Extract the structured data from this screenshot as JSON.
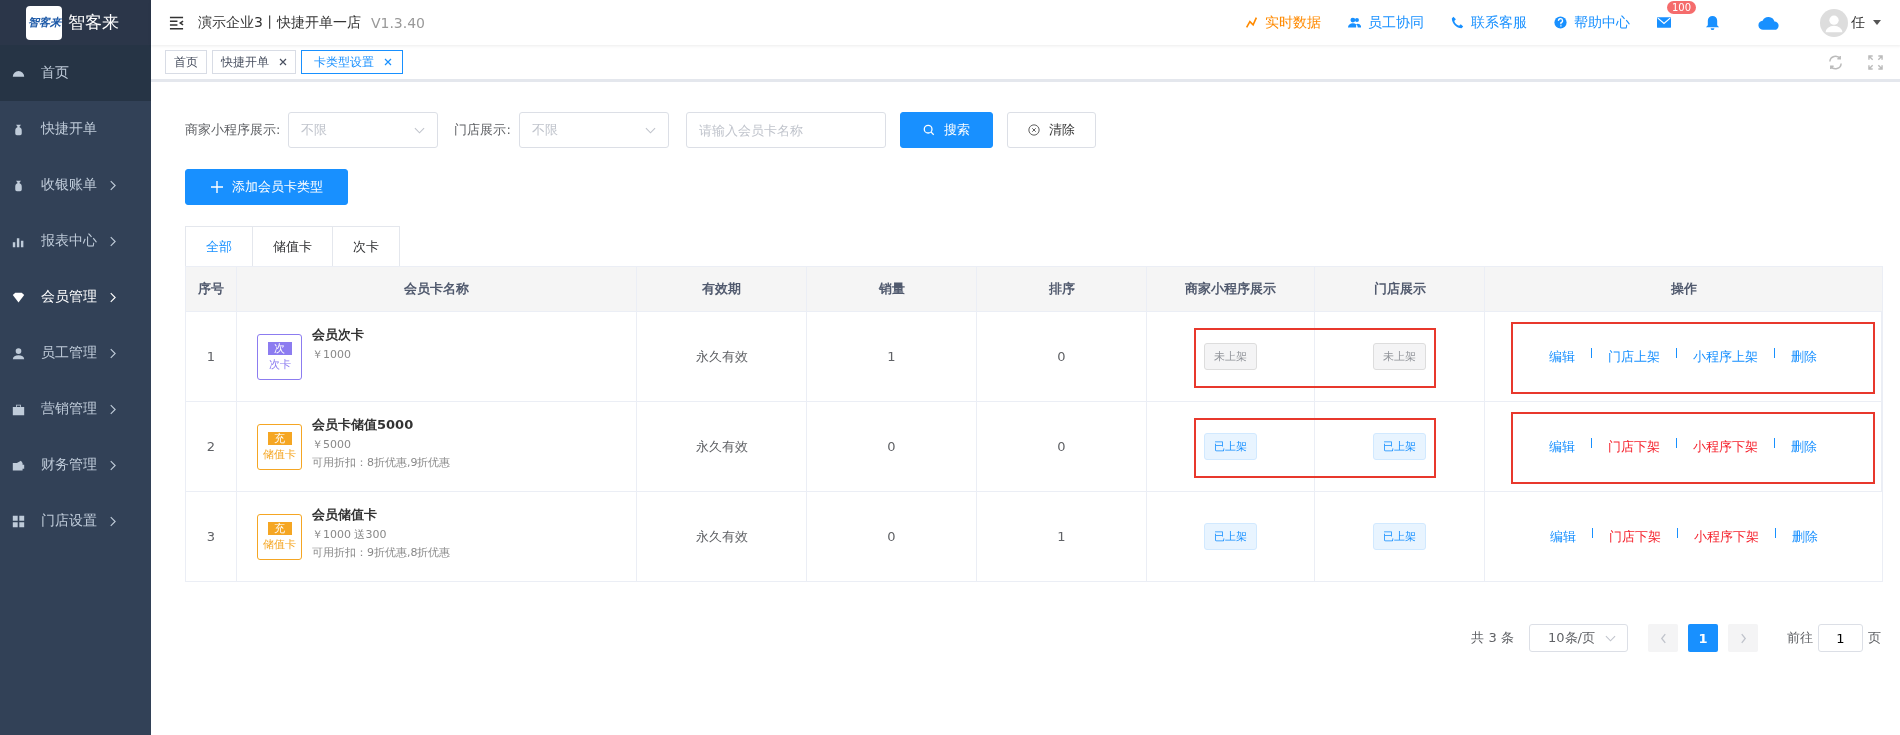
{
  "logo": {
    "name": "智客来",
    "badge_text": "智客来"
  },
  "header": {
    "title": "演示企业3丨快捷开单一店",
    "version": "V1.3.40",
    "links": [
      {
        "label": "实时数据",
        "kind": "chart",
        "color": "#ff8a00"
      },
      {
        "label": "员工协同",
        "kind": "users",
        "color": "#1890ff"
      },
      {
        "label": "联系客服",
        "kind": "phone",
        "color": "#1890ff"
      },
      {
        "label": "帮助中心",
        "kind": "help",
        "color": "#1890ff"
      }
    ],
    "mail_badge": "100",
    "user": "任"
  },
  "page_tabs": [
    {
      "label": "首页",
      "selected": false,
      "closable": false
    },
    {
      "label": "快捷开单",
      "selected": false,
      "closable": true
    },
    {
      "label": "卡类型设置",
      "selected": true,
      "closable": true
    }
  ],
  "sidebar": {
    "items": [
      {
        "label": "首页",
        "selected": true,
        "current": false,
        "has_children": false
      },
      {
        "label": "快捷开单",
        "selected": false,
        "current": false,
        "has_children": false
      },
      {
        "label": "收银账单",
        "selected": false,
        "current": false,
        "has_children": true
      },
      {
        "label": "报表中心",
        "selected": false,
        "current": false,
        "has_children": true
      },
      {
        "label": "会员管理",
        "selected": false,
        "current": true,
        "has_children": true
      },
      {
        "label": "员工管理",
        "selected": false,
        "current": false,
        "has_children": true
      },
      {
        "label": "营销管理",
        "selected": false,
        "current": false,
        "has_children": true
      },
      {
        "label": "财务管理",
        "selected": false,
        "current": false,
        "has_children": true
      },
      {
        "label": "门店设置",
        "selected": false,
        "current": false,
        "has_children": true
      }
    ]
  },
  "filters": {
    "mini_label": "商家小程序展示:",
    "mini_placeholder": "不限",
    "store_label": "门店展示:",
    "store_placeholder": "不限",
    "name_placeholder": "请输入会员卡名称",
    "search_button": "搜索",
    "clear_button": "清除"
  },
  "add_button": "添加会员卡类型",
  "type_tabs": [
    {
      "label": "全部",
      "selected": true
    },
    {
      "label": "储值卡",
      "selected": false
    },
    {
      "label": "次卡",
      "selected": false
    }
  ],
  "table": {
    "columns": [
      "序号",
      "会员卡名称",
      "有效期",
      "销量",
      "排序",
      "商家小程序展示",
      "门店展示",
      "操作"
    ],
    "rows": [
      {
        "index": "1",
        "kind": "count",
        "icon_top": "次",
        "icon_label": "次卡",
        "name": "会员次卡",
        "price": "￥1000",
        "discount": null,
        "validity": "永久有效",
        "sales": "1",
        "sort": "0",
        "mini_status": {
          "label": "未上架",
          "listed": false
        },
        "store_status": {
          "label": "未上架",
          "listed": false
        },
        "annotated": true,
        "actions": [
          {
            "label": "编辑",
            "kind": "plain"
          },
          {
            "label": "门店上架",
            "kind": "plain"
          },
          {
            "label": "小程序上架",
            "kind": "plain"
          },
          {
            "label": "删除",
            "kind": "plain"
          }
        ]
      },
      {
        "index": "2",
        "kind": "stored",
        "icon_top": "充",
        "icon_label": "储值卡",
        "name": "会员卡储值5000",
        "price": "￥5000",
        "discount": "可用折扣：8折优惠,9折优惠",
        "validity": "永久有效",
        "sales": "0",
        "sort": "0",
        "mini_status": {
          "label": "已上架",
          "listed": true
        },
        "store_status": {
          "label": "已上架",
          "listed": true
        },
        "annotated": true,
        "actions": [
          {
            "label": "编辑",
            "kind": "plain"
          },
          {
            "label": "门店下架",
            "kind": "danger"
          },
          {
            "label": "小程序下架",
            "kind": "danger"
          },
          {
            "label": "删除",
            "kind": "plain"
          }
        ]
      },
      {
        "index": "3",
        "kind": "stored",
        "icon_top": "充",
        "icon_label": "储值卡",
        "name": "会员储值卡",
        "price": "￥1000 送300",
        "discount": "可用折扣：9折优惠,8折优惠",
        "validity": "永久有效",
        "sales": "0",
        "sort": "1",
        "mini_status": {
          "label": "已上架",
          "listed": true
        },
        "store_status": {
          "label": "已上架",
          "listed": true
        },
        "annotated": false,
        "actions": [
          {
            "label": "编辑",
            "kind": "plain"
          },
          {
            "label": "门店下架",
            "kind": "danger"
          },
          {
            "label": "小程序下架",
            "kind": "danger"
          },
          {
            "label": "删除",
            "kind": "plain"
          }
        ]
      }
    ]
  },
  "pagination": {
    "total": "共 3 条",
    "page_size": "10条/页",
    "pages": [
      {
        "label": "1",
        "selected": true
      }
    ],
    "goto_label": "前往",
    "goto_value": "1",
    "goto_suffix": "页"
  }
}
